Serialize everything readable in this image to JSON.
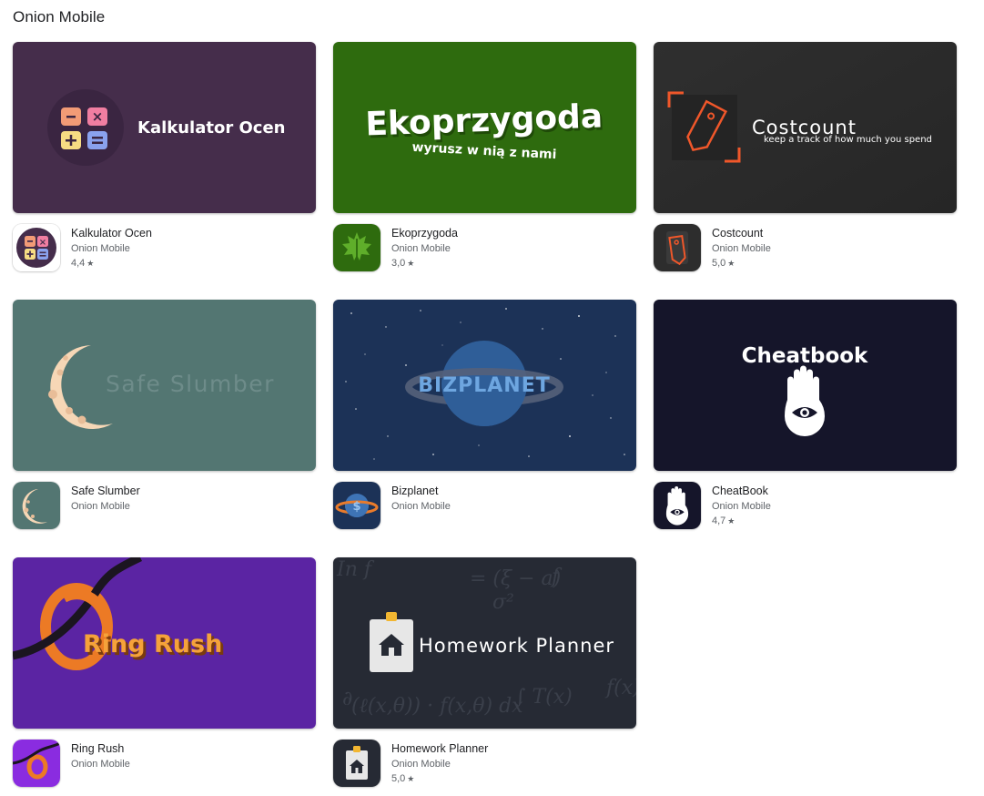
{
  "page": {
    "title": "Onion Mobile"
  },
  "apps": [
    {
      "name": "Kalkulator Ocen",
      "developer": "Onion Mobile",
      "rating": "4,4",
      "banner_title": "Kalkulator Ocen",
      "icon": "calculator-icon",
      "colors": {
        "banner_bg": "#452d4b",
        "key_minus": "#f29b76",
        "key_times": "#f07ea1",
        "key_plus": "#f6dc83",
        "key_equals": "#8aa2ee"
      }
    },
    {
      "name": "Ekoprzygoda",
      "developer": "Onion Mobile",
      "rating": "3,0",
      "banner_title": "Ekoprzygoda",
      "banner_subtitle": "wyrusz w nią z nami",
      "icon": "leaf-icon",
      "colors": {
        "banner_bg": "#2e6b0e"
      }
    },
    {
      "name": "Costcount",
      "developer": "Onion Mobile",
      "rating": "5,0",
      "banner_title": "Costcount",
      "banner_subtitle": "keep a track of how much you spend",
      "icon": "price-tag-icon",
      "colors": {
        "banner_bg": "#2d2d2d",
        "accent": "#f0572a"
      }
    },
    {
      "name": "Safe Slumber",
      "developer": "Onion Mobile",
      "rating": "",
      "banner_title": "Safe Slumber",
      "icon": "moon-icon",
      "colors": {
        "banner_bg": "#537672",
        "moon": "#f6d7b6"
      }
    },
    {
      "name": "Bizplanet",
      "developer": "Onion Mobile",
      "rating": "",
      "banner_title": "BIZPLANET",
      "icon": "planet-dollar-icon",
      "colors": {
        "banner_bg": "#1c3257",
        "planet": "#3e74b6",
        "ring": "#e97b2b"
      }
    },
    {
      "name": "CheatBook",
      "developer": "Onion Mobile",
      "rating": "4,7",
      "banner_title": "Cheatbook",
      "icon": "hamsa-eye-icon",
      "colors": {
        "banner_bg": "#15152a"
      }
    },
    {
      "name": "Ring Rush",
      "developer": "Onion Mobile",
      "rating": "",
      "banner_title": "Ring Rush",
      "icon": "ring-icon",
      "colors": {
        "banner_bg": "#5b24a3",
        "ring": "#ec7a25"
      }
    },
    {
      "name": "Homework Planner",
      "developer": "Onion Mobile",
      "rating": "5,0",
      "banner_title": "Homework Planner",
      "icon": "clipboard-house-icon",
      "colors": {
        "banner_bg": "#262a34",
        "clip": "#f2b631"
      }
    }
  ],
  "star_glyph": "★"
}
